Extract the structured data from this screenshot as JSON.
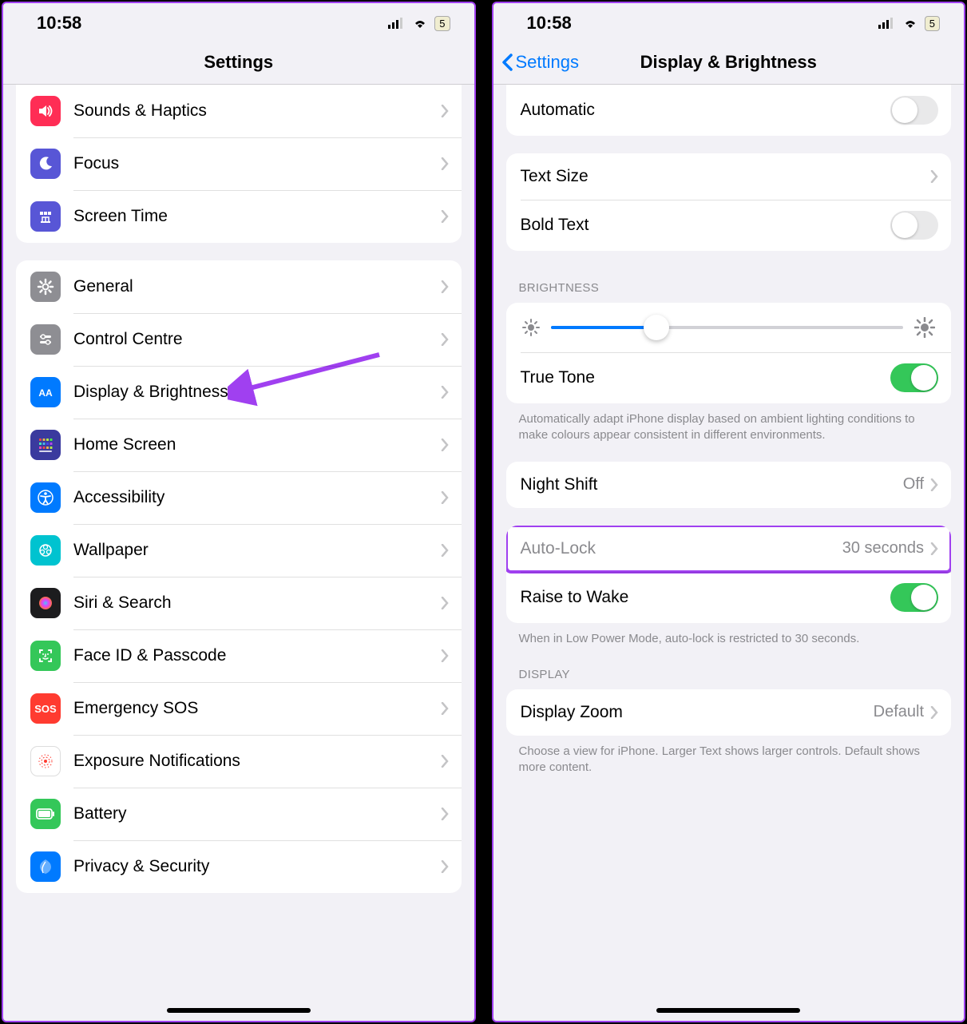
{
  "status": {
    "time": "10:58",
    "battery": "5"
  },
  "left": {
    "title": "Settings",
    "items_top": [
      {
        "label": "Sounds & Haptics",
        "icon": "sounds"
      },
      {
        "label": "Focus",
        "icon": "focus"
      },
      {
        "label": "Screen Time",
        "icon": "screentime"
      }
    ],
    "items_bottom": [
      {
        "label": "General",
        "icon": "general"
      },
      {
        "label": "Control Centre",
        "icon": "control"
      },
      {
        "label": "Display & Brightness",
        "icon": "display"
      },
      {
        "label": "Home Screen",
        "icon": "home"
      },
      {
        "label": "Accessibility",
        "icon": "access"
      },
      {
        "label": "Wallpaper",
        "icon": "wallpaper"
      },
      {
        "label": "Siri & Search",
        "icon": "siri"
      },
      {
        "label": "Face ID & Passcode",
        "icon": "faceid"
      },
      {
        "label": "Emergency SOS",
        "icon": "sos"
      },
      {
        "label": "Exposure Notifications",
        "icon": "exposure"
      },
      {
        "label": "Battery",
        "icon": "battery"
      },
      {
        "label": "Privacy & Security",
        "icon": "privacy"
      }
    ]
  },
  "right": {
    "back": "Settings",
    "title": "Display & Brightness",
    "automatic": "Automatic",
    "textSize": "Text Size",
    "boldText": "Bold Text",
    "brightnessHeader": "BRIGHTNESS",
    "trueTone": "True Tone",
    "trueToneFooter": "Automatically adapt iPhone display based on ambient lighting conditions to make colours appear consistent in different environments.",
    "nightShift": "Night Shift",
    "nightShiftValue": "Off",
    "autoLock": "Auto-Lock",
    "autoLockValue": "30 seconds",
    "raiseToWake": "Raise to Wake",
    "raiseFooter": "When in Low Power Mode, auto-lock is restricted to 30 seconds.",
    "displayHeader": "DISPLAY",
    "displayZoom": "Display Zoom",
    "displayZoomValue": "Default",
    "displayZoomFooter": "Choose a view for iPhone. Larger Text shows larger controls. Default shows more content.",
    "brightnessValue": 30
  },
  "iconColors": {
    "sounds": "#ff2d55",
    "focus": "#5856d6",
    "screentime": "#5856d6",
    "general": "#8e8e93",
    "control": "#8e8e93",
    "display": "#007aff",
    "home": "#3a3a9e",
    "access": "#007aff",
    "wallpaper": "#00c3d0",
    "siri": "#1c1c1e",
    "faceid": "#34c759",
    "sos": "#ff3b30",
    "exposure": "#ffffff",
    "battery": "#34c759",
    "privacy": "#007aff"
  }
}
